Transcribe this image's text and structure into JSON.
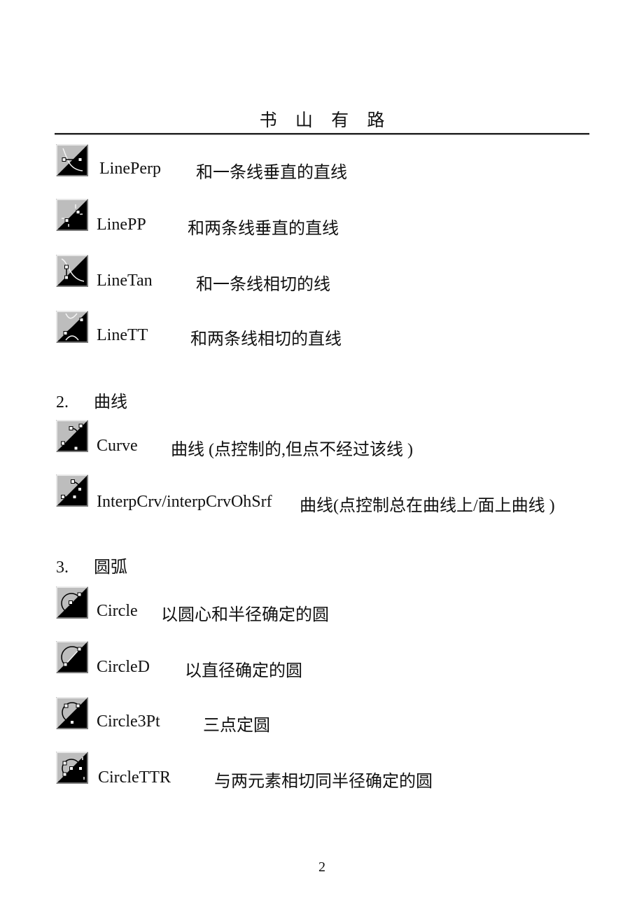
{
  "header": {
    "chars": [
      "书",
      "山",
      "有",
      "路"
    ]
  },
  "lines": [
    {
      "icon": "line-perp-icon",
      "command": "LinePerp",
      "description": "和一条线垂直的直线"
    },
    {
      "icon": "line-pp-icon",
      "command": "LinePP",
      "description": "和两条线垂直的直线"
    },
    {
      "icon": "line-tan-icon",
      "command": "LineTan",
      "description": "和一条线相切的线"
    },
    {
      "icon": "line-tt-icon",
      "command": "LineTT",
      "description": "和两条线相切的直线"
    }
  ],
  "sections": [
    {
      "number": "2.",
      "title": "曲线"
    },
    {
      "number": "3.",
      "title": "圆弧"
    }
  ],
  "curves": [
    {
      "icon": "curve-icon",
      "command": "Curve",
      "description": "曲线  (点控制的,但点不经过该线  )"
    },
    {
      "icon": "interp-curve-icon",
      "command": "InterpCrv/interpCrvOhSrf",
      "description": "曲线(点控制总在曲线上/面上曲线  )"
    }
  ],
  "circles": [
    {
      "icon": "circle-icon",
      "command": "Circle",
      "description": "以圆心和半径确定的圆"
    },
    {
      "icon": "circle-diameter-icon",
      "command": "CircleD",
      "description": "以直径确定的圆"
    },
    {
      "icon": "circle-3pt-icon",
      "command": "Circle3Pt",
      "description": "三点定圆"
    },
    {
      "icon": "circle-ttr-icon",
      "command": "CircleTTR",
      "description": "与两元素相切同半径确定的圆"
    }
  ],
  "page_number": "2"
}
